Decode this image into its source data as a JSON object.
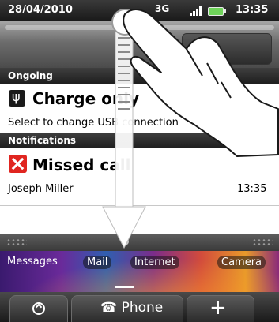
{
  "status_bar": {
    "date": "28/04/2010",
    "network": "3G",
    "time": "13:35"
  },
  "sections": {
    "ongoing": "Ongoing",
    "notifications": "Notifications"
  },
  "ongoing_item": {
    "title": "Charge only",
    "subtitle": "Select to change USB connection"
  },
  "notification_item": {
    "title": "Missed call",
    "caller": "Joseph Miller",
    "time": "13:35"
  },
  "home_shortcuts": [
    "Messages",
    "Mail",
    "Internet",
    "Camera"
  ],
  "dock": {
    "phone_label": "Phone"
  },
  "icons": {
    "ongoing": "usb-icon",
    "notification": "missed-call-icon",
    "dock_left": "app-drawer-icon",
    "dock_right": "plus-icon"
  },
  "colors": {
    "missed_call": "#e02520",
    "battery": "#6fd35a"
  }
}
